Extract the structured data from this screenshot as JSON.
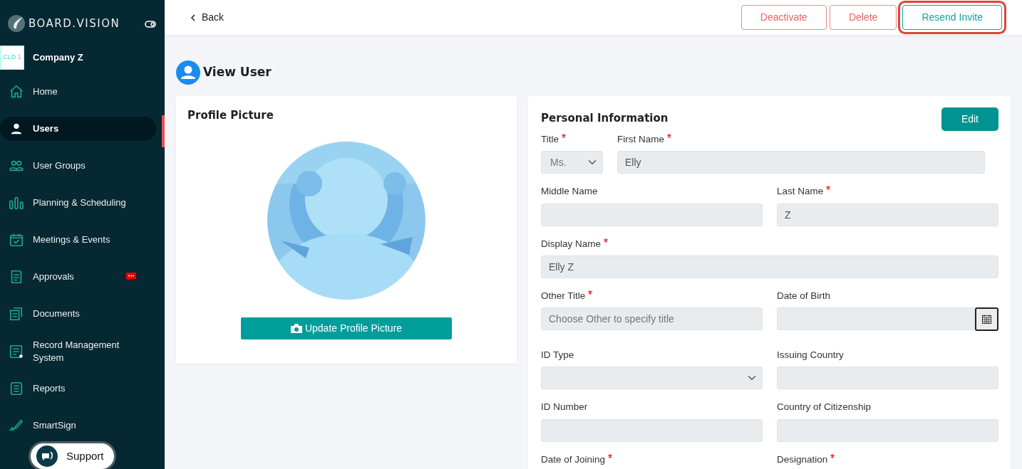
{
  "brand": {
    "name": "BOARD.VISION"
  },
  "company": {
    "logo_text": "CLD 1",
    "name": "Company Z"
  },
  "sidebar": {
    "items": [
      {
        "label": "Home",
        "selected": false,
        "notification": false
      },
      {
        "label": "Users",
        "selected": true,
        "notification": false
      },
      {
        "label": "User Groups",
        "selected": false,
        "notification": false
      },
      {
        "label": "Planning & Scheduling",
        "selected": false,
        "notification": false
      },
      {
        "label": "Meetings & Events",
        "selected": false,
        "notification": false
      },
      {
        "label": "Approvals",
        "selected": false,
        "notification": true
      },
      {
        "label": "Documents",
        "selected": false,
        "notification": false
      },
      {
        "label": "Record Management System",
        "selected": false,
        "notification": false
      },
      {
        "label": "Reports",
        "selected": false,
        "notification": false
      },
      {
        "label": "SmartSign",
        "selected": false,
        "notification": false
      }
    ]
  },
  "support": {
    "label": "Support"
  },
  "header": {
    "back": "Back",
    "buttons": [
      {
        "label": "Deactivate",
        "kind": "danger",
        "focused": false
      },
      {
        "label": "Delete",
        "kind": "danger",
        "focused": false
      },
      {
        "label": "Resend Invite",
        "kind": "primary",
        "focused": true
      }
    ]
  },
  "page_title": "View User",
  "profile": {
    "title": "Profile Picture",
    "button": "Update Profile Picture"
  },
  "personal": {
    "title": "Personal Information",
    "edit": "Edit",
    "rows": [
      [
        {
          "label": "Title",
          "required": true,
          "kind": "select",
          "value": "Ms."
        },
        {
          "label": "First Name",
          "required": true,
          "kind": "text",
          "value": "Elly"
        }
      ],
      [
        {
          "label": "Middle Name",
          "required": false,
          "kind": "text"
        },
        {
          "label": "Last Name",
          "required": true,
          "kind": "text",
          "value": "Z"
        }
      ],
      [
        {
          "label": "Display Name",
          "required": true,
          "kind": "text",
          "value": "Elly Z"
        }
      ],
      [
        {
          "label": "Other Title",
          "required": true,
          "kind": "text",
          "placeholder": "Choose Other to specify title"
        },
        {
          "label": "Date of Birth",
          "required": false,
          "kind": "date"
        }
      ],
      [
        {
          "label": "ID Type",
          "required": false,
          "kind": "select"
        },
        {
          "label": "Issuing Country",
          "required": false,
          "kind": "text"
        }
      ],
      [
        {
          "label": "ID Number",
          "required": false,
          "kind": "text"
        },
        {
          "label": "Country of Citizenship",
          "required": false,
          "kind": "text"
        }
      ],
      [
        {
          "label": "Date of Joining",
          "required": true
        },
        {
          "label": "Designation",
          "required": true
        }
      ]
    ]
  }
}
